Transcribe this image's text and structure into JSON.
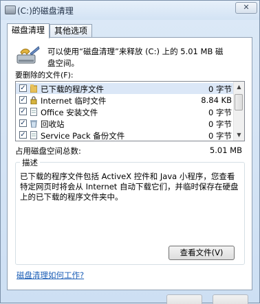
{
  "window": {
    "title": "(C:)的磁盘清理",
    "close_glyph": "✕"
  },
  "tabs": [
    {
      "label": "磁盘清理",
      "active": true
    },
    {
      "label": "其他选项",
      "active": false
    }
  ],
  "main": {
    "intro": "可以使用“磁盘清理”来释放 (C:) 上的 5.01 MB 磁\n盘空间。",
    "files_to_delete_label": "要删除的文件(F):",
    "files": [
      {
        "name": "已下载的程序文件",
        "size": "0 字节",
        "checked": true,
        "icon": "folder-icon",
        "selected": true
      },
      {
        "name": "Internet 临时文件",
        "size": "8.84 KB",
        "checked": true,
        "icon": "lock-icon",
        "selected": false
      },
      {
        "name": "Office 安装文件",
        "size": "0 字节",
        "checked": true,
        "icon": "document-icon",
        "selected": false
      },
      {
        "name": "回收站",
        "size": "0 字节",
        "checked": true,
        "icon": "recycle-bin-icon",
        "selected": false
      },
      {
        "name": "Service Pack 备份文件",
        "size": "0 字节",
        "checked": true,
        "icon": "document-icon",
        "selected": false
      }
    ],
    "total_label": "占用磁盘空间总数:",
    "total_value": "5.01 MB",
    "description_title": "描述",
    "description_text": "已下载的程序文件包括 ActiveX 控件和 Java 小程序，您查看特定网页时将会从 Internet 自动下载它们，并临时保存在硬盘上的已下载的程序文件夹中。",
    "view_files_button": "查看文件(V)",
    "help_link": "磁盘清理如何工作?",
    "check_glyph": "✓",
    "scroll_up_glyph": "▲",
    "scroll_down_glyph": "▼"
  },
  "colors": {
    "accent": "#1a5db6",
    "selection": "#dbe7f7",
    "window_bg": "#dce9f7"
  }
}
